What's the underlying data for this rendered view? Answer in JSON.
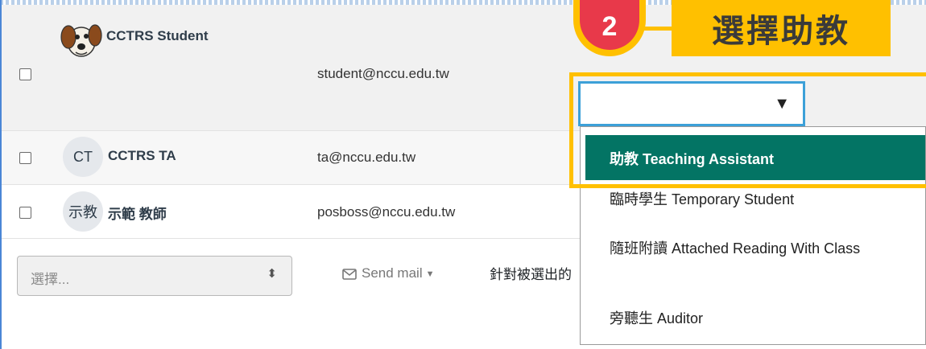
{
  "participants": [
    {
      "name": "CCTRS Student",
      "email": "student@nccu.edu.tw",
      "avatar": "dog-avatar-icon",
      "checked": false
    },
    {
      "name": "CCTRS TA",
      "email": "ta@nccu.edu.tw",
      "initials": "CT",
      "checked": false
    },
    {
      "name": "示範 教師",
      "email": "posboss@nccu.edu.tw",
      "initials": "示教",
      "checked": false
    }
  ],
  "bulk_actions": {
    "select_placeholder": "選擇...",
    "send_mail_label": "Send mail",
    "selected_users_text": "針對被選出的"
  },
  "callout": {
    "step_number": "2",
    "label": "選擇助教",
    "accent_color": "#ffc000",
    "badge_color": "#e8394a"
  },
  "role_select": {
    "value": "",
    "options": [
      {
        "label": "助教 Teaching Assistant",
        "selected": true
      },
      {
        "label": "臨時學生 Temporary Student",
        "selected": false
      },
      {
        "label": "隨班附讀 Attached Reading With Class",
        "selected": false
      },
      {
        "label": "旁聽生 Auditor",
        "selected": false
      }
    ],
    "selected_color": "#037464"
  }
}
